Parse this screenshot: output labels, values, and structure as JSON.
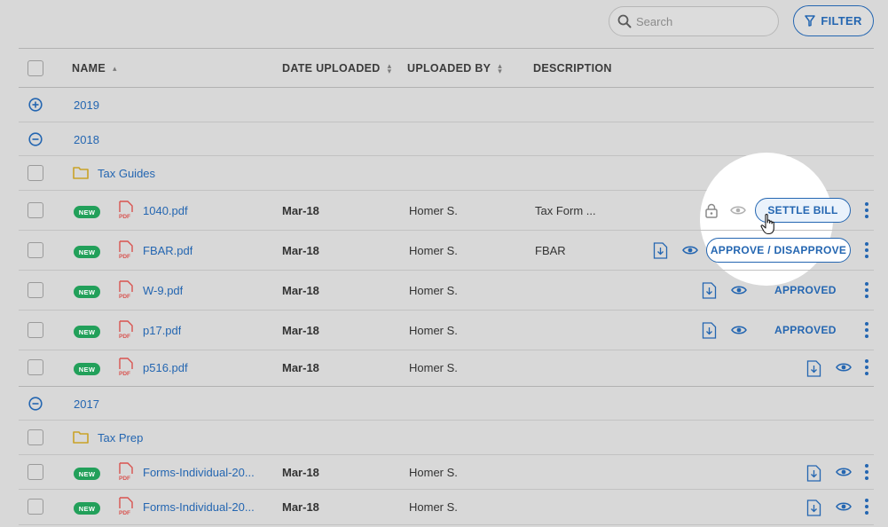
{
  "toolbar": {
    "search_placeholder": "Search",
    "filter_label": "FILTER"
  },
  "columns": {
    "name": "NAME",
    "date_uploaded": "DATE UPLOADED",
    "uploaded_by": "UPLOADED BY",
    "description": "DESCRIPTION"
  },
  "groups": {
    "y2019": {
      "label": "2019",
      "state": "collapsed"
    },
    "y2018": {
      "label": "2018",
      "state": "expanded",
      "folder": "Tax Guides",
      "files": [
        {
          "badge": "NEW",
          "name": "1040.pdf",
          "date": "Mar-18",
          "by": "Homer S.",
          "description": "Tax Form ...",
          "action": "SETTLE BILL"
        },
        {
          "badge": "NEW",
          "name": "FBAR.pdf",
          "date": "Mar-18",
          "by": "Homer S.",
          "description": "FBAR",
          "action": "APPROVE / DISAPPROVE"
        },
        {
          "badge": "NEW",
          "name": "W-9.pdf",
          "date": "Mar-18",
          "by": "Homer S.",
          "description": "",
          "status": "APPROVED"
        },
        {
          "badge": "NEW",
          "name": "p17.pdf",
          "date": "Mar-18",
          "by": "Homer S.",
          "description": "",
          "status": "APPROVED"
        },
        {
          "badge": "NEW",
          "name": "p516.pdf",
          "date": "Mar-18",
          "by": "Homer S.",
          "description": ""
        }
      ]
    },
    "y2017": {
      "label": "2017",
      "state": "expanded",
      "folder": "Tax Prep",
      "files": [
        {
          "badge": "NEW",
          "name": "Forms-Individual-20...",
          "date": "Mar-18",
          "by": "Homer S."
        },
        {
          "badge": "NEW",
          "name": "Forms-Individual-20...",
          "date": "Mar-18",
          "by": "Homer S."
        }
      ]
    }
  },
  "pdf_label": "PDF",
  "colors": {
    "accent": "#2466b1",
    "badge_green": "#22a05a",
    "pdf_red": "#d9534f",
    "folder_gold": "#c9a227"
  }
}
